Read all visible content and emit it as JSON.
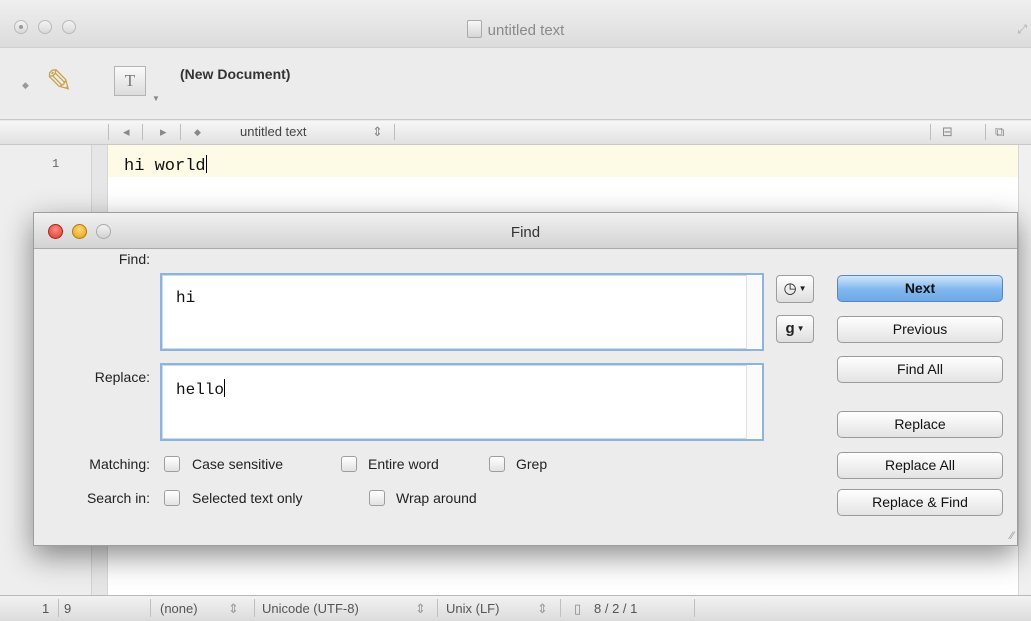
{
  "window": {
    "title": "untitled text",
    "doc_state": "(New Document)",
    "tool_glyph": "T",
    "nav_title": "untitled text",
    "line_number": "1",
    "content": "hi world"
  },
  "status": {
    "line": "1",
    "column": "9",
    "language": "(none)",
    "encoding": "Unicode (UTF-8)",
    "line_endings": "Unix (LF)",
    "counts": "8 / 2 / 1"
  },
  "find_dialog": {
    "title": "Find",
    "find_label": "Find:",
    "find_value": "hi",
    "replace_label": "Replace:",
    "replace_value": "hello",
    "matching_label": "Matching:",
    "search_in_label": "Search in:",
    "options": {
      "case_sensitive": "Case sensitive",
      "entire_word": "Entire word",
      "grep": "Grep",
      "selected_text_only": "Selected text only",
      "wrap_around": "Wrap around"
    },
    "grep_glyph": "g",
    "buttons": {
      "next": "Next",
      "previous": "Previous",
      "find_all": "Find All",
      "replace": "Replace",
      "replace_all": "Replace All",
      "replace_and_find": "Replace & Find"
    }
  },
  "icons": [
    "close-icon",
    "minimize-icon",
    "zoom-icon",
    "pencil-icon",
    "document-icon",
    "history-icon",
    "chevron-down-icon",
    "resize-grip-icon"
  ],
  "colors": {
    "default_button": "#7fb6ee",
    "field_focus": "#8fb3dc",
    "current_line": "#fdfbe6"
  }
}
